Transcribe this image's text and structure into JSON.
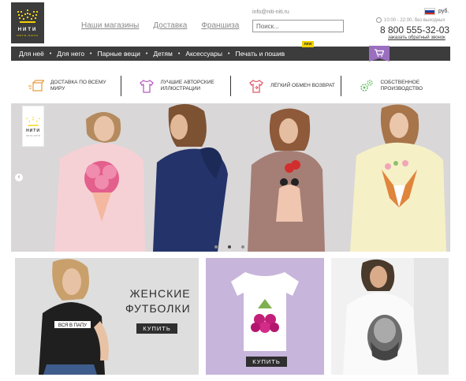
{
  "header": {
    "logo_text": "НИТИ",
    "logo_sub": "нити-нити",
    "nav": [
      "Наши магазины",
      "Доставка",
      "Франшиза"
    ],
    "email": "info@niti-niti.ru",
    "search_placeholder": "Поиск...",
    "currency": "руб.",
    "hours": "10:00 - 22:00, без выходных",
    "phone": "8 800 555-32-03",
    "callback": "заказать обратный звонок"
  },
  "navbar": {
    "items": [
      "Для неё",
      "Для него",
      "Парные вещи",
      "Детям",
      "Аксессуары",
      "Печать и пошив"
    ],
    "badge": "new"
  },
  "features": [
    "Доставка по всему миру",
    "Лучшие авторские иллюстрации",
    "Лёгкий обмен возврат",
    "Собственное производство"
  ],
  "hero": {
    "logo_text": "НИТИ",
    "logo_sub": "нити-нити",
    "arrow": "‹",
    "slides": 3,
    "active_slide": 2
  },
  "tiles": {
    "tile1_title_line1": "Женские",
    "tile1_title_line2": "футболки",
    "tile1_shirt_text": "ВСЯ В ПАПУ",
    "buy_label": "КУПИТЬ"
  },
  "colors": {
    "dark": "#3c3c3c",
    "accent": "#f3d200",
    "purple": "#9b6fbf",
    "feature_icon": "#e8a14a"
  },
  "icons": {
    "search": "search-icon",
    "cart": "cart-icon",
    "clock": "clock-icon",
    "flag": "russia-flag-icon"
  }
}
